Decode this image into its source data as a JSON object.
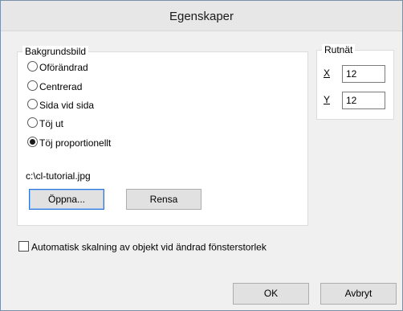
{
  "window": {
    "title": "Egenskaper"
  },
  "background_group": {
    "legend": "Bakgrundsbild",
    "options": [
      {
        "label": "Oförändrad",
        "checked": false
      },
      {
        "label": "Centrerad",
        "checked": false
      },
      {
        "label": "Sida vid sida",
        "checked": false
      },
      {
        "label": "Töj ut",
        "checked": false
      },
      {
        "label": "Töj proportionellt",
        "checked": true
      }
    ],
    "selected": "Töj proportionellt",
    "filename": "c:\\cl-tutorial.jpg",
    "open_button": "Öppna...",
    "clear_button": "Rensa"
  },
  "grid_group": {
    "legend": "Rutnät",
    "x_label": "X",
    "x_value": "12",
    "y_label": "Y",
    "y_value": "12"
  },
  "auto_scale": {
    "label": "Automatisk skalning av objekt vid ändrad fönsterstorlek",
    "checked": false
  },
  "footer": {
    "ok_label": "OK",
    "cancel_label": "Avbryt"
  },
  "colors": {
    "titlebar": "#e7e7e7",
    "dialog_bg": "#f0f0f0",
    "focus_border": "#2f75d6"
  }
}
